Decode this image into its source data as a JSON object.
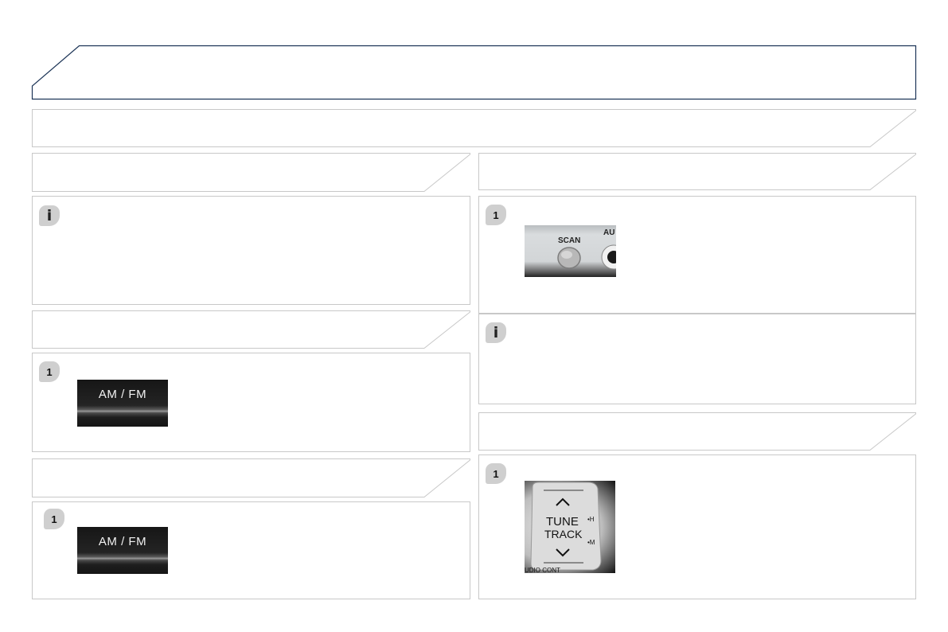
{
  "badges": {
    "info_glyph": "i",
    "step_number": "1"
  },
  "buttons": {
    "am_fm_label": "AM / FM",
    "scan_label": "SCAN",
    "aux_label": "AU",
    "tune_label": "TUNE",
    "track_label": "TRACK",
    "h_label": "•H",
    "m_label": "•M",
    "audio_cont_label": "UDIO CONT"
  },
  "colors": {
    "title_border": "#1d3557",
    "panel_border": "#c8c8c8",
    "badge_fill": "#cfcfcf"
  }
}
